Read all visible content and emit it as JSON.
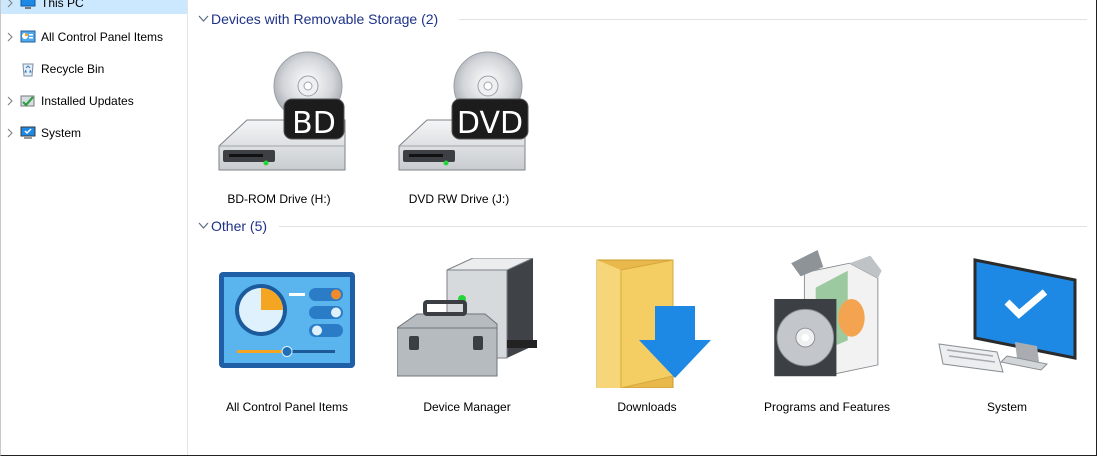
{
  "nav": {
    "items": [
      {
        "label": "This PC"
      },
      {
        "label": "All Control Panel Items"
      },
      {
        "label": "Recycle Bin"
      },
      {
        "label": "Installed Updates"
      },
      {
        "label": "System"
      }
    ]
  },
  "groups": {
    "removable": {
      "title": "Devices with Removable Storage (2)",
      "items": [
        {
          "label": "BD-ROM Drive (H:)",
          "badge": "BD",
          "icon": "bd-drive-icon"
        },
        {
          "label": "DVD RW Drive (J:)",
          "badge": "DVD",
          "icon": "dvd-drive-icon"
        }
      ]
    },
    "other": {
      "title": "Other (5)",
      "items": [
        {
          "label": "All Control Panel Items",
          "icon": "control-panel-icon"
        },
        {
          "label": "Device Manager",
          "icon": "device-manager-icon"
        },
        {
          "label": "Downloads",
          "icon": "downloads-folder-icon"
        },
        {
          "label": "Programs and Features",
          "icon": "programs-features-icon"
        },
        {
          "label": "System",
          "icon": "system-monitor-icon"
        }
      ]
    }
  },
  "colors": {
    "selection": "#cce8ff",
    "group_title": "#1e3287",
    "accent_blue": "#1e88e5"
  }
}
